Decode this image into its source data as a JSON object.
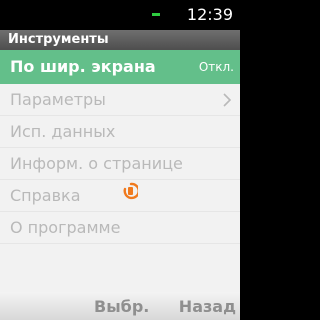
{
  "status": {
    "time": "12:39"
  },
  "title": "Инструменты",
  "menu": {
    "items": [
      {
        "label": "По шир. экрана",
        "value": "Откл."
      },
      {
        "label": "Параметры"
      },
      {
        "label": "Исп. данных"
      },
      {
        "label": "Информ. о странице"
      },
      {
        "label": "Справка"
      },
      {
        "label": "О программе"
      }
    ]
  },
  "softkeys": {
    "select": "Выбр.",
    "back": "Назад"
  },
  "colors": {
    "selected": "#63bf8a",
    "accent": "#f07a1e"
  }
}
